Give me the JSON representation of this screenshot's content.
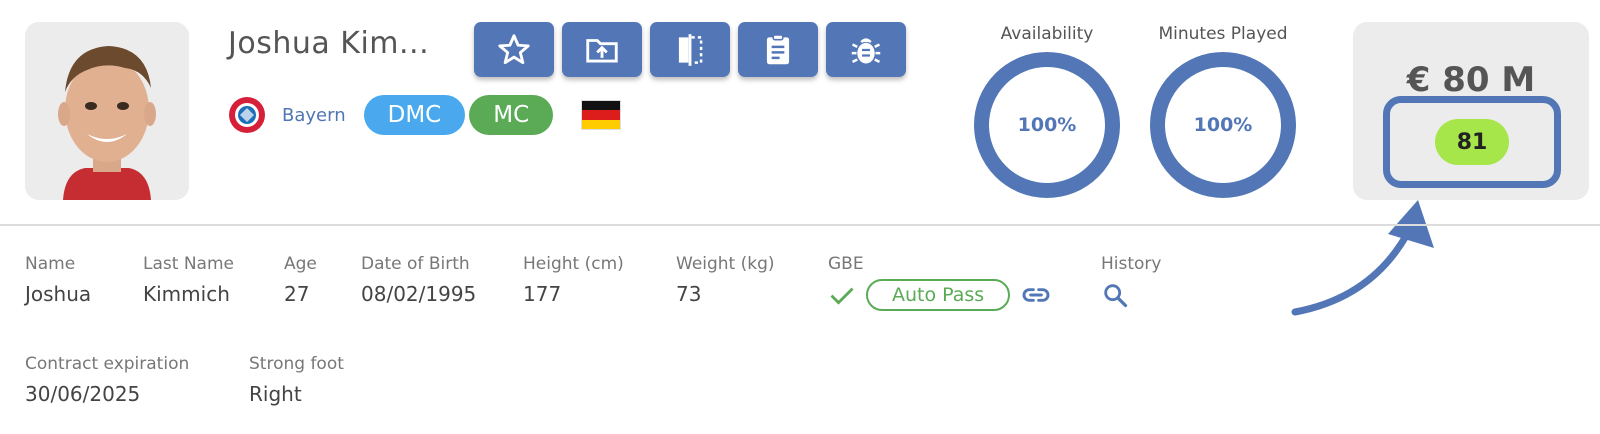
{
  "header": {
    "player_name": "Joshua Kim...",
    "club": "Bayern",
    "positions": [
      {
        "label": "DMC",
        "color": "#4aa9ee"
      },
      {
        "label": "MC",
        "color": "#5aaa56"
      }
    ],
    "nationality_flag": "germany-flag",
    "toolbar_icons": [
      "star-icon",
      "folder-upload-icon",
      "compare-icon",
      "clipboard-icon",
      "bug-icon"
    ]
  },
  "gauges": [
    {
      "label": "Availability",
      "value": "100%",
      "percent": 100
    },
    {
      "label": "Minutes Played",
      "value": "100%",
      "percent": 100
    }
  ],
  "value_card": {
    "market_value": "€ 80 M",
    "rating": "81",
    "rating_color": "#a6e64b"
  },
  "details": {
    "name": {
      "label": "Name",
      "value": "Joshua"
    },
    "last_name": {
      "label": "Last Name",
      "value": "Kimmich"
    },
    "age": {
      "label": "Age",
      "value": "27"
    },
    "dob": {
      "label": "Date of Birth",
      "value": "08/02/1995"
    },
    "height": {
      "label": "Height (cm)",
      "value": "177"
    },
    "weight": {
      "label": "Weight (kg)",
      "value": "73"
    },
    "gbe": {
      "label": "GBE",
      "status": "Auto Pass"
    },
    "history": {
      "label": "History"
    },
    "contract": {
      "label": "Contract expiration",
      "value": "30/06/2025"
    },
    "foot": {
      "label": "Strong foot",
      "value": "Right"
    }
  },
  "colors": {
    "accent": "#5377b6",
    "green": "#5aaa56",
    "blue": "#4aa9ee"
  }
}
